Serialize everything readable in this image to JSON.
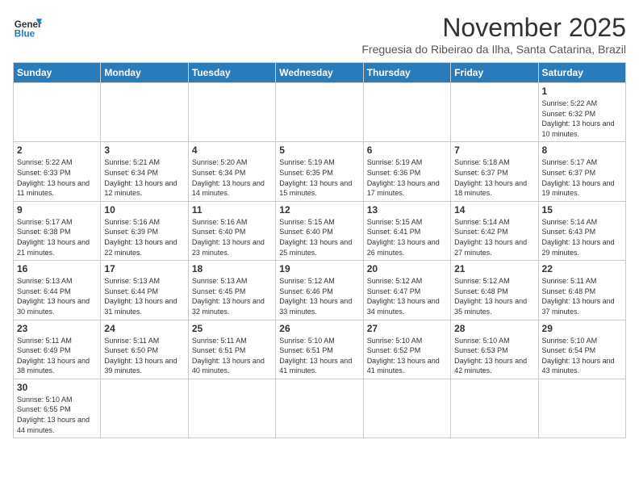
{
  "header": {
    "logo_general": "General",
    "logo_blue": "Blue",
    "month": "November 2025",
    "location": "Freguesia do Ribeirao da Ilha, Santa Catarina, Brazil"
  },
  "weekdays": [
    "Sunday",
    "Monday",
    "Tuesday",
    "Wednesday",
    "Thursday",
    "Friday",
    "Saturday"
  ],
  "weeks": [
    [
      {
        "day": "",
        "info": ""
      },
      {
        "day": "",
        "info": ""
      },
      {
        "day": "",
        "info": ""
      },
      {
        "day": "",
        "info": ""
      },
      {
        "day": "",
        "info": ""
      },
      {
        "day": "",
        "info": ""
      },
      {
        "day": "1",
        "info": "Sunrise: 5:22 AM\nSunset: 6:32 PM\nDaylight: 13 hours and 10 minutes."
      }
    ],
    [
      {
        "day": "2",
        "info": "Sunrise: 5:22 AM\nSunset: 6:33 PM\nDaylight: 13 hours and 11 minutes."
      },
      {
        "day": "3",
        "info": "Sunrise: 5:21 AM\nSunset: 6:34 PM\nDaylight: 13 hours and 12 minutes."
      },
      {
        "day": "4",
        "info": "Sunrise: 5:20 AM\nSunset: 6:34 PM\nDaylight: 13 hours and 14 minutes."
      },
      {
        "day": "5",
        "info": "Sunrise: 5:19 AM\nSunset: 6:35 PM\nDaylight: 13 hours and 15 minutes."
      },
      {
        "day": "6",
        "info": "Sunrise: 5:19 AM\nSunset: 6:36 PM\nDaylight: 13 hours and 17 minutes."
      },
      {
        "day": "7",
        "info": "Sunrise: 5:18 AM\nSunset: 6:37 PM\nDaylight: 13 hours and 18 minutes."
      },
      {
        "day": "8",
        "info": "Sunrise: 5:17 AM\nSunset: 6:37 PM\nDaylight: 13 hours and 19 minutes."
      }
    ],
    [
      {
        "day": "9",
        "info": "Sunrise: 5:17 AM\nSunset: 6:38 PM\nDaylight: 13 hours and 21 minutes."
      },
      {
        "day": "10",
        "info": "Sunrise: 5:16 AM\nSunset: 6:39 PM\nDaylight: 13 hours and 22 minutes."
      },
      {
        "day": "11",
        "info": "Sunrise: 5:16 AM\nSunset: 6:40 PM\nDaylight: 13 hours and 23 minutes."
      },
      {
        "day": "12",
        "info": "Sunrise: 5:15 AM\nSunset: 6:40 PM\nDaylight: 13 hours and 25 minutes."
      },
      {
        "day": "13",
        "info": "Sunrise: 5:15 AM\nSunset: 6:41 PM\nDaylight: 13 hours and 26 minutes."
      },
      {
        "day": "14",
        "info": "Sunrise: 5:14 AM\nSunset: 6:42 PM\nDaylight: 13 hours and 27 minutes."
      },
      {
        "day": "15",
        "info": "Sunrise: 5:14 AM\nSunset: 6:43 PM\nDaylight: 13 hours and 29 minutes."
      }
    ],
    [
      {
        "day": "16",
        "info": "Sunrise: 5:13 AM\nSunset: 6:44 PM\nDaylight: 13 hours and 30 minutes."
      },
      {
        "day": "17",
        "info": "Sunrise: 5:13 AM\nSunset: 6:44 PM\nDaylight: 13 hours and 31 minutes."
      },
      {
        "day": "18",
        "info": "Sunrise: 5:13 AM\nSunset: 6:45 PM\nDaylight: 13 hours and 32 minutes."
      },
      {
        "day": "19",
        "info": "Sunrise: 5:12 AM\nSunset: 6:46 PM\nDaylight: 13 hours and 33 minutes."
      },
      {
        "day": "20",
        "info": "Sunrise: 5:12 AM\nSunset: 6:47 PM\nDaylight: 13 hours and 34 minutes."
      },
      {
        "day": "21",
        "info": "Sunrise: 5:12 AM\nSunset: 6:48 PM\nDaylight: 13 hours and 35 minutes."
      },
      {
        "day": "22",
        "info": "Sunrise: 5:11 AM\nSunset: 6:48 PM\nDaylight: 13 hours and 37 minutes."
      }
    ],
    [
      {
        "day": "23",
        "info": "Sunrise: 5:11 AM\nSunset: 6:49 PM\nDaylight: 13 hours and 38 minutes."
      },
      {
        "day": "24",
        "info": "Sunrise: 5:11 AM\nSunset: 6:50 PM\nDaylight: 13 hours and 39 minutes."
      },
      {
        "day": "25",
        "info": "Sunrise: 5:11 AM\nSunset: 6:51 PM\nDaylight: 13 hours and 40 minutes."
      },
      {
        "day": "26",
        "info": "Sunrise: 5:10 AM\nSunset: 6:51 PM\nDaylight: 13 hours and 41 minutes."
      },
      {
        "day": "27",
        "info": "Sunrise: 5:10 AM\nSunset: 6:52 PM\nDaylight: 13 hours and 41 minutes."
      },
      {
        "day": "28",
        "info": "Sunrise: 5:10 AM\nSunset: 6:53 PM\nDaylight: 13 hours and 42 minutes."
      },
      {
        "day": "29",
        "info": "Sunrise: 5:10 AM\nSunset: 6:54 PM\nDaylight: 13 hours and 43 minutes."
      }
    ],
    [
      {
        "day": "30",
        "info": "Sunrise: 5:10 AM\nSunset: 6:55 PM\nDaylight: 13 hours and 44 minutes."
      },
      {
        "day": "",
        "info": ""
      },
      {
        "day": "",
        "info": ""
      },
      {
        "day": "",
        "info": ""
      },
      {
        "day": "",
        "info": ""
      },
      {
        "day": "",
        "info": ""
      },
      {
        "day": "",
        "info": ""
      }
    ]
  ]
}
